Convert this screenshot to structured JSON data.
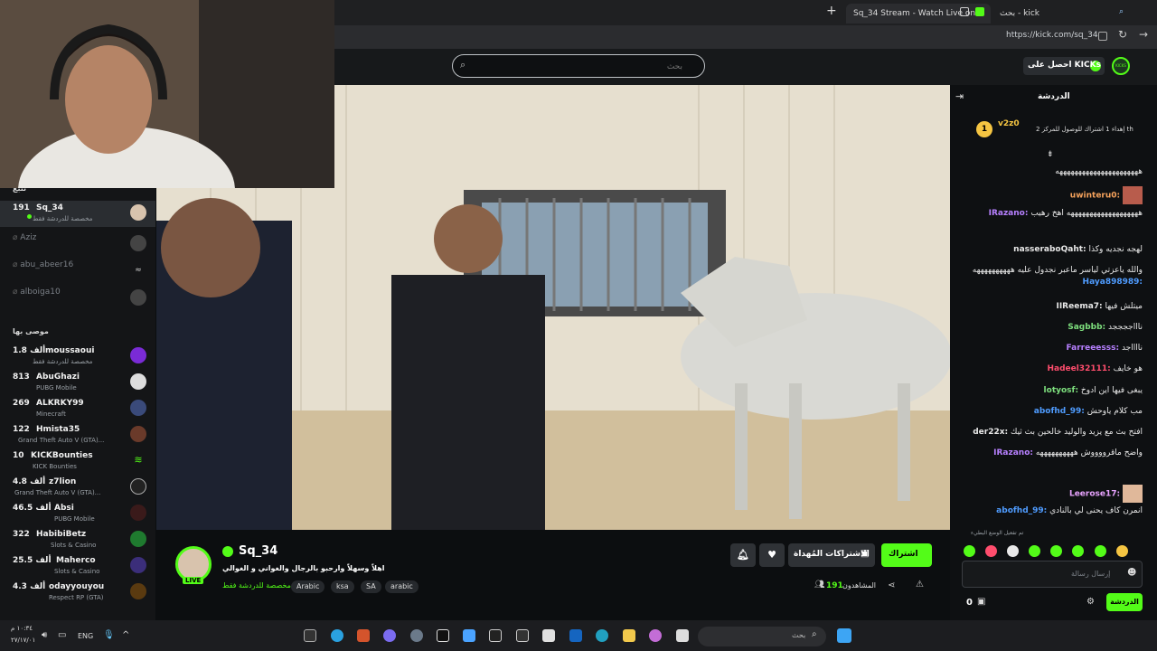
{
  "browser": {
    "tabs": [
      {
        "label": "Sq_34 Stream - Watch Live on",
        "active": true
      },
      {
        "label": "بحث - kick",
        "active": false
      }
    ],
    "url": "https://kick.com/sq_34",
    "search_tab_label": "بحث"
  },
  "header": {
    "search_placeholder": "بحث",
    "get_kicks_label": "احصل على KICKs",
    "logo_badge": "KICKS"
  },
  "sidebar": {
    "section_following": "تتبع",
    "section_recommended": "موصى بها",
    "following": [
      {
        "viewers": "191",
        "name": "Sq_34",
        "category": "مخصصة للدردشة فقط",
        "live": true
      },
      {
        "name": "Aziz",
        "live": false
      },
      {
        "name": "abu_abeer16",
        "live": false
      },
      {
        "name": "alboiga10",
        "live": false
      }
    ],
    "recommended": [
      {
        "viewers": "1.8 ألف",
        "name": "moussaoui",
        "category": "مخصصة للدردشة فقط"
      },
      {
        "viewers": "813",
        "name": "AbuGhazi",
        "category": "PUBG Mobile"
      },
      {
        "viewers": "269",
        "name": "ALKRKY99",
        "category": "Minecraft"
      },
      {
        "viewers": "122",
        "name": "Hmista35",
        "category": "Grand Theft Auto V (GTA)..."
      },
      {
        "viewers": "10",
        "name": "KICKBounties",
        "category": "KICK Bounties"
      },
      {
        "viewers": "4.8 ألف",
        "name": "z7lion",
        "category": "Grand Theft Auto V (GTA)..."
      },
      {
        "viewers": "46.5 ألف",
        "name": "Absi",
        "category": "PUBG Mobile"
      },
      {
        "viewers": "322",
        "name": "HabibiBetz",
        "category": "Slots & Casino"
      },
      {
        "viewers": "25.5 ألف",
        "name": "Maherco",
        "category": "Slots & Casino"
      },
      {
        "viewers": "4.3 ألف",
        "name": "odayyouyou",
        "category": "Respect RP (GTA)"
      }
    ]
  },
  "stream": {
    "channel_name": "Sq_34",
    "title": "اهلاً وسهلاً وارحبو بالرجال والغواني و الغوالي",
    "category": "مخصصة للدردشة فقط",
    "tags": [
      "Arabic",
      "ksa",
      "SA",
      "arabic"
    ],
    "viewers_label": "المشاهدون",
    "viewers": "191",
    "live_badge": "LIVE",
    "subscribe_label": "اشتراك",
    "gift_subs_label": "الاشتراكات المُهداة"
  },
  "chat": {
    "title": "الدردشة",
    "pinned": {
      "user": "v2z0",
      "level": "1",
      "text": "إهداء 1 اشتراك للوصول للمركز 2 th"
    },
    "messages": [
      {
        "user": "",
        "text": "ههههههههههههههههههههههه",
        "color": "#e8e8e8"
      },
      {
        "user": "uwinteru0:",
        "text": "",
        "color": "#f7a35c"
      },
      {
        "user": "IRazano:",
        "text": "هههههههههههههههههههه اهخ رهيب",
        "color": "#b780ff"
      },
      {
        "user": "nasseraboQaht:",
        "text": "لهجه نجديه وكذا",
        "color": "#e8e8e8"
      },
      {
        "user": "Haya898989:",
        "text": "والله ياعزتي لياسر ماعبر نجدول عليه ههههههههههه",
        "color": "#4f9cff"
      },
      {
        "user": "IIReema7:",
        "text": "ميتلش فيها",
        "color": "#e8e8e8"
      },
      {
        "user": "Sagbbb:",
        "text": "ناااججججد",
        "color": "#7ee07e"
      },
      {
        "user": "Farreeesss:",
        "text": "نااااجد",
        "color": "#b780ff"
      },
      {
        "user": "Hadeel32111:",
        "text": "هو خايف",
        "color": "#ff4d6d"
      },
      {
        "user": "lotyosf:",
        "text": "يبغى فيها اين ادوخ",
        "color": "#7ee07e"
      },
      {
        "user": "abofhd_99:",
        "text": "مب كلام ياوحش",
        "color": "#4f9cff"
      },
      {
        "user": "der22x:",
        "text": "افتح بث مع يزيد والوليد خالحين بث ثيك",
        "color": "#e8e8e8"
      },
      {
        "user": "IRazano:",
        "text": "واضح ماقرووووش ههههههههههه",
        "color": "#b780ff"
      },
      {
        "user": "Leerose17:",
        "text": "",
        "color": "#e8a3ff"
      },
      {
        "user": "abofhd_99:",
        "text": "انمرن كاف يحنى لي بالنادي",
        "color": "#4f9cff"
      }
    ],
    "slow_mode_notice": "تم تفعيل الوضع البطيء",
    "input_placeholder": "إرسال رسالة",
    "send_label": "الدردشة",
    "points": "0"
  },
  "taskbar": {
    "search_placeholder": "بحث",
    "time": "١٠:٣٤ م",
    "date": "٢٧/١٧/٠١",
    "lang": "ENG"
  },
  "colors": {
    "accent": "#53fc18",
    "bg": "#0b0e0f"
  }
}
